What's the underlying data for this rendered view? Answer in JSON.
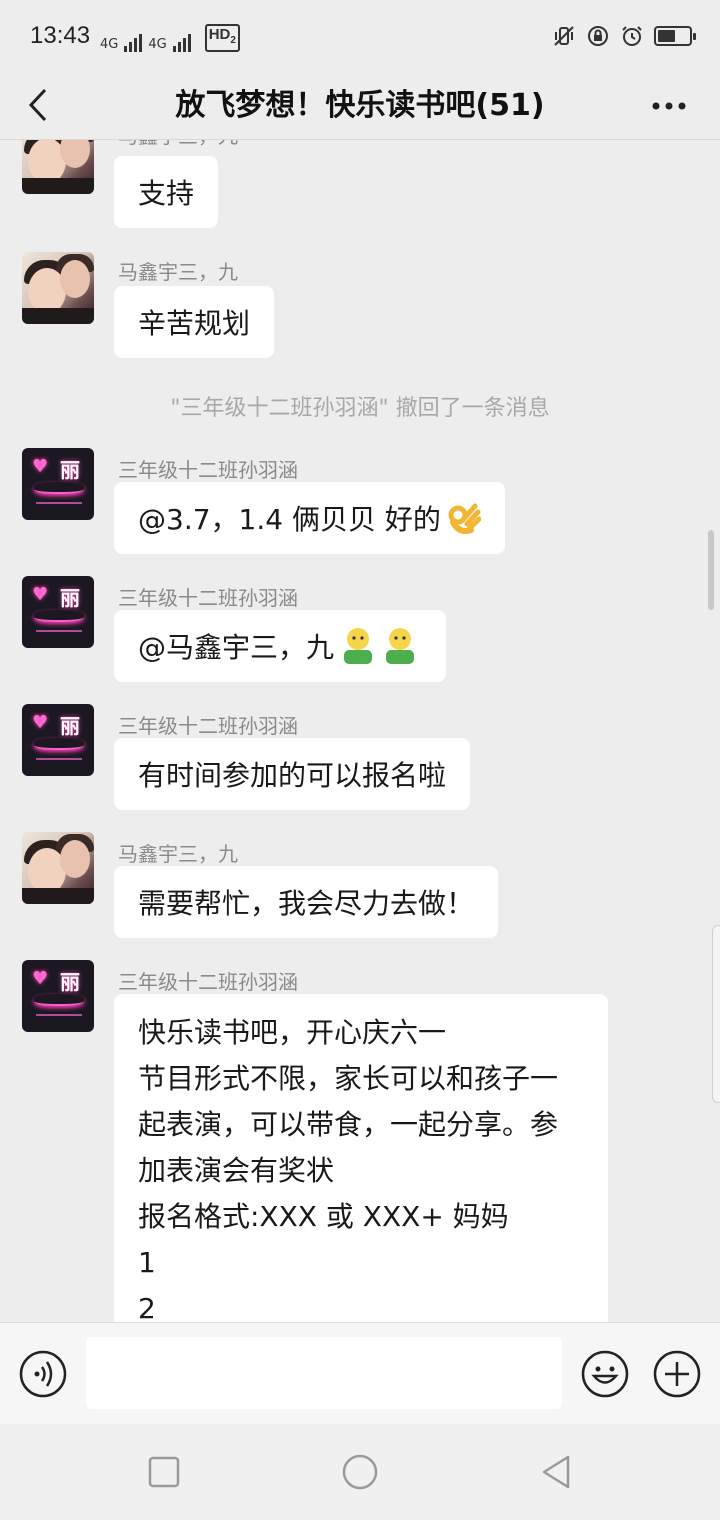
{
  "status_bar": {
    "time": "13:43",
    "network_left": "4G",
    "network_right": "4G",
    "hd_label": "HD",
    "hd_sub": "2"
  },
  "navbar": {
    "title": "放飞梦想！快乐读书吧(51)",
    "more_label": "···"
  },
  "system_notice": "\"三年级十二班孙羽涵\" 撤回了一条消息",
  "messages": [
    {
      "sender": "马鑫宇三，九",
      "text": "支持"
    },
    {
      "sender": "马鑫宇三，九",
      "text": "辛苦规划"
    },
    {
      "sender": "三年级十二班孙羽涵",
      "text": "@3.7，1.4 俩贝贝   好的"
    },
    {
      "sender": "三年级十二班孙羽涵",
      "text": "@马鑫宇三，九 "
    },
    {
      "sender": "三年级十二班孙羽涵",
      "text": "有时间参加的可以报名啦"
    },
    {
      "sender": "马鑫宇三，九",
      "text": "需要帮忙，我会尽力去做！"
    },
    {
      "sender": "三年级十二班孙羽涵",
      "lines": [
        "快乐读书吧，开心庆六一",
        "节目形式不限，家长可以和孩子一",
        "起表演，可以带食，一起分享。参",
        "加表演会有奖状",
        "报名格式:XXX 或 XXX+ 妈妈",
        "1",
        "2"
      ]
    }
  ],
  "avatar_neon_text": "丽",
  "icons": {
    "back": "chevron-left-icon",
    "more": "more-dots-icon",
    "voice": "voice-icon",
    "emoji": "emoji-icon",
    "plus": "plus-icon",
    "ok_hand": "ok-hand-emoji",
    "hug": "hug-emoji"
  },
  "input": {
    "placeholder": "",
    "value": ""
  }
}
